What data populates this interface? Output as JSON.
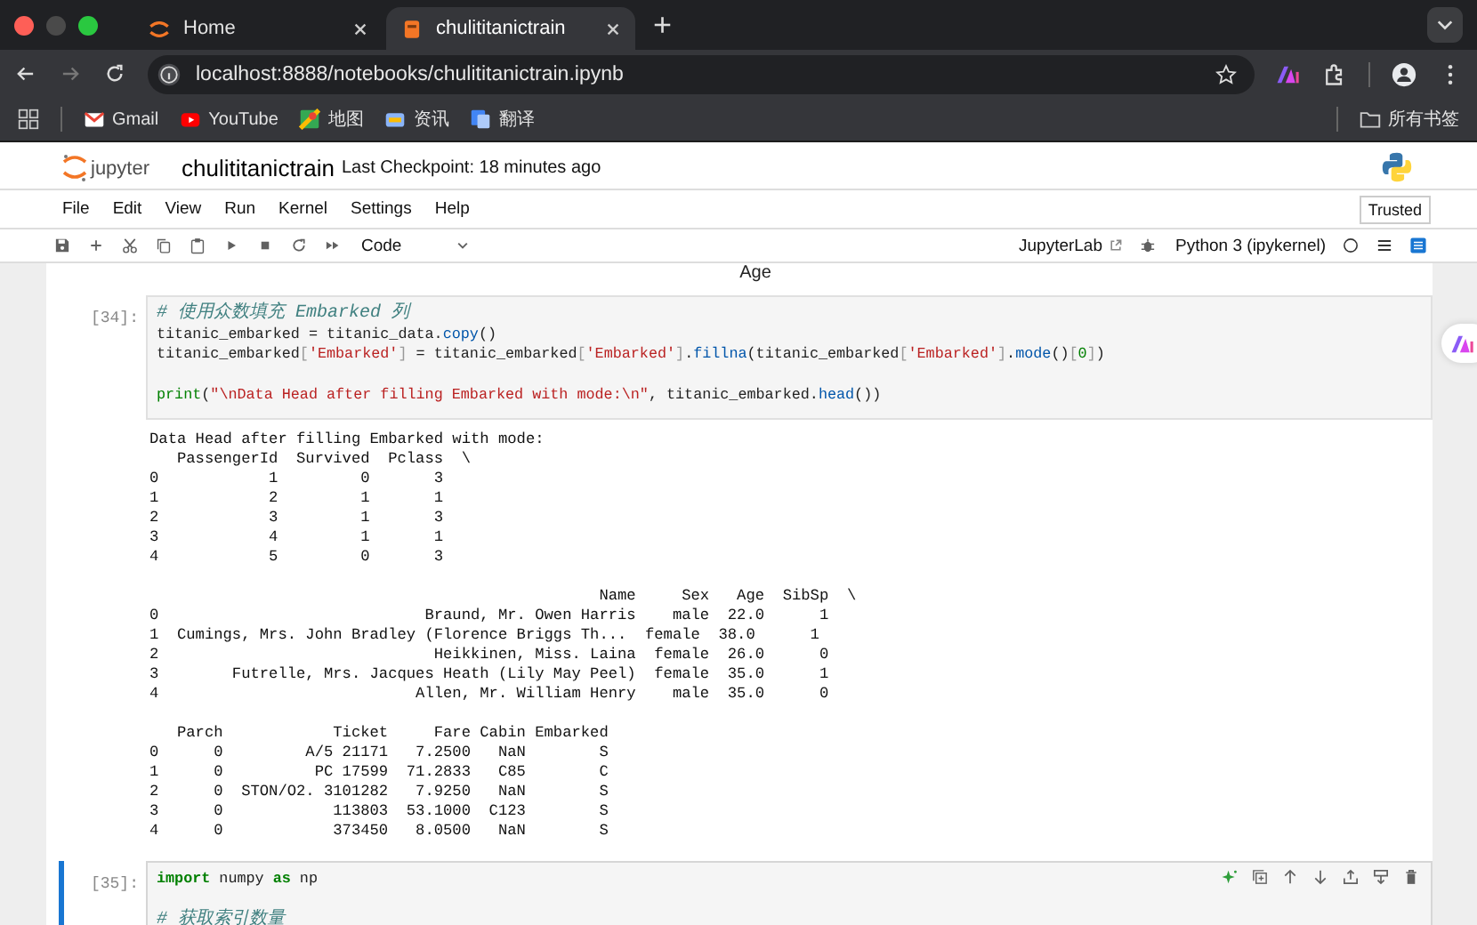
{
  "browser": {
    "tabs": [
      {
        "title": "Home",
        "selected": false
      },
      {
        "title": "chulititanictrain",
        "selected": true
      }
    ],
    "new_tab": "+",
    "url": "localhost:8888/notebooks/chulititanictrain.ipynb",
    "bookmarks": [
      {
        "label": "Gmail"
      },
      {
        "label": "YouTube"
      },
      {
        "label": "地图"
      },
      {
        "label": "资讯"
      },
      {
        "label": "翻译"
      }
    ],
    "all_bookmarks": "所有书签"
  },
  "jupyter": {
    "logo_text": "jupyter",
    "notebook_name": "chulititanictrain",
    "checkpoint": "Last Checkpoint: 18 minutes ago",
    "menu": [
      "File",
      "Edit",
      "View",
      "Run",
      "Kernel",
      "Settings",
      "Help"
    ],
    "trusted": "Trusted",
    "cell_type": "Code",
    "jupyterlab": "JupyterLab",
    "kernel": "Python 3 (ipykernel)"
  },
  "notebook": {
    "figure_label": "Age",
    "cells": [
      {
        "prompt": "[34]:",
        "active": false,
        "code": [
          {
            "tokens": [
              {
                "t": "# 使用众数填充 Embarked 列",
                "kind": "comment"
              }
            ]
          },
          {
            "tokens": [
              {
                "t": "titanic_embarked = titanic_data.",
                "kind": "plain"
              },
              {
                "t": "copy",
                "kind": "method"
              },
              {
                "t": "()",
                "kind": "plain"
              }
            ]
          },
          {
            "tokens": [
              {
                "t": "titanic_embarked",
                "kind": "plain"
              },
              {
                "t": "[",
                "kind": "punct"
              },
              {
                "t": "'Embarked'",
                "kind": "str"
              },
              {
                "t": "]",
                "kind": "punct"
              },
              {
                "t": " = titanic_embarked",
                "kind": "plain"
              },
              {
                "t": "[",
                "kind": "punct"
              },
              {
                "t": "'Embarked'",
                "kind": "str"
              },
              {
                "t": "]",
                "kind": "punct"
              },
              {
                "t": ".",
                "kind": "plain"
              },
              {
                "t": "fillna",
                "kind": "method"
              },
              {
                "t": "(titanic_embarked",
                "kind": "plain"
              },
              {
                "t": "[",
                "kind": "punct"
              },
              {
                "t": "'Embarked'",
                "kind": "str"
              },
              {
                "t": "]",
                "kind": "punct"
              },
              {
                "t": ".",
                "kind": "plain"
              },
              {
                "t": "mode",
                "kind": "method"
              },
              {
                "t": "()",
                "kind": "plain"
              },
              {
                "t": "[",
                "kind": "punct"
              },
              {
                "t": "0",
                "kind": "num"
              },
              {
                "t": "]",
                "kind": "punct"
              },
              {
                "t": ")",
                "kind": "plain"
              }
            ]
          },
          {
            "blank_before": true,
            "tokens": [
              {
                "t": "print",
                "kind": "builtin"
              },
              {
                "t": "(",
                "kind": "plain"
              },
              {
                "t": "\"\\nData Head after filling Embarked with mode:\\n\"",
                "kind": "str"
              },
              {
                "t": ", titanic_embarked.",
                "kind": "plain"
              },
              {
                "t": "head",
                "kind": "method"
              },
              {
                "t": "())",
                "kind": "plain"
              }
            ]
          }
        ],
        "output": [
          [
            "Data Head after filling Embarked with mode:",
            "   PassengerId  Survived  Pclass  \\",
            "0            1         0       3",
            "1            2         1       1",
            "2            3         1       3",
            "3            4         1       1",
            "4            5         0       3"
          ],
          [
            "                                                 Name     Sex   Age  SibSp  \\",
            "0                             Braund, Mr. Owen Harris    male  22.0      1",
            "1  Cumings, Mrs. John Bradley (Florence Briggs Th...  female  38.0      1",
            "2                              Heikkinen, Miss. Laina  female  26.0      0",
            "3        Futrelle, Mrs. Jacques Heath (Lily May Peel)  female  35.0      1",
            "4                            Allen, Mr. William Henry    male  35.0      0"
          ],
          [
            "   Parch            Ticket     Fare Cabin Embarked",
            "0      0         A/5 21171   7.2500   NaN        S",
            "1      0          PC 17599  71.2833   C85        C",
            "2      0  STON/O2. 3101282   7.9250   NaN        S",
            "3      0            113803  53.1000  C123        S",
            "4      0            373450   8.0500   NaN        S"
          ]
        ]
      },
      {
        "prompt": "[35]:",
        "active": true,
        "code": [
          {
            "tokens": [
              {
                "t": "import",
                "kind": "keyword"
              },
              {
                "t": " numpy ",
                "kind": "plain"
              },
              {
                "t": "as",
                "kind": "keyword"
              },
              {
                "t": " np",
                "kind": "plain"
              }
            ]
          },
          {
            "blank_before": true,
            "tokens": [
              {
                "t": "# 获取索引数量",
                "kind": "comment"
              }
            ]
          }
        ]
      }
    ]
  }
}
